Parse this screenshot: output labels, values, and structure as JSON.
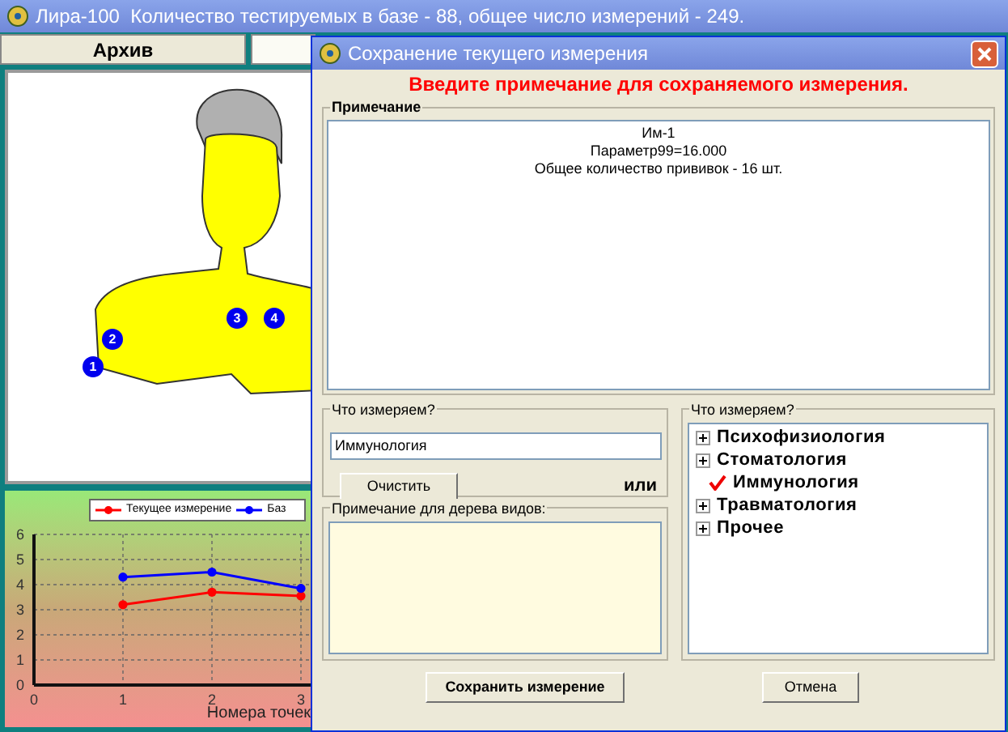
{
  "main_window": {
    "title": "Лира-100  Количество тестируемых в базе - 88, общее число измерений - 249.",
    "tabs": [
      {
        "label": "Архив",
        "selected": false
      },
      {
        "selected": true
      }
    ]
  },
  "body_map": {
    "markers": [
      {
        "label": "1"
      },
      {
        "label": "2"
      },
      {
        "label": "3"
      },
      {
        "label": "4"
      }
    ]
  },
  "chart": {
    "chart_data": {
      "type": "line",
      "xlabel": "Номера точек",
      "grid": true,
      "legend": true,
      "x": [
        1,
        2,
        3
      ],
      "xlim": [
        0,
        3
      ],
      "ylim": [
        0,
        6
      ],
      "xticks": [
        0,
        1,
        2,
        3
      ],
      "yticks": [
        0,
        1,
        2,
        3,
        4,
        5,
        6
      ],
      "series": [
        {
          "name": "Текущее измерение",
          "color": "#ff0000",
          "marker": "circle",
          "values": [
            3.2,
            3.7,
            3.55
          ]
        },
        {
          "name": "Баз",
          "color": "#0000ff",
          "marker": "circle",
          "values": [
            4.3,
            4.5,
            3.85
          ]
        }
      ]
    }
  },
  "dialog": {
    "title": "Сохранение текущего измерения",
    "prompt": "Введите примечание для сохраняемого измерения.",
    "note": {
      "label": "Примечание",
      "lines": [
        "Им-1",
        "Параметр99=16.000",
        "Общее количество прививок - 16 шт."
      ]
    },
    "what_measured": {
      "label": "Что измеряем?",
      "value": "Иммунология",
      "clear_button": "Очистить",
      "or_label": "или"
    },
    "tree_note": {
      "label": "Примечание для дерева видов:"
    },
    "tree": {
      "label": "Что измеряем?",
      "items": [
        {
          "label": "Психофизиология",
          "checked": false
        },
        {
          "label": "Стоматология",
          "checked": false
        },
        {
          "label": "Иммунология",
          "checked": true
        },
        {
          "label": "Травматология",
          "checked": false
        },
        {
          "label": "Прочее",
          "checked": false
        }
      ]
    },
    "buttons": [
      "Сохранить измерение",
      "Отмена"
    ]
  }
}
